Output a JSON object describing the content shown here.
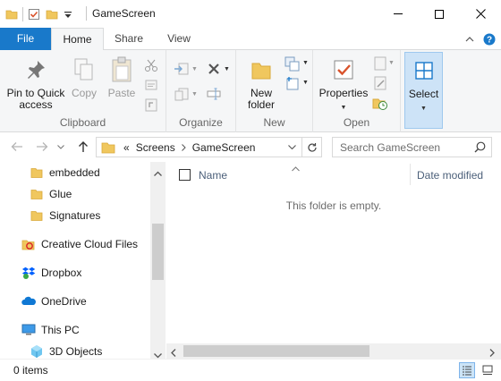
{
  "window": {
    "title": "GameScreen"
  },
  "tabs": {
    "file": "File",
    "home": "Home",
    "share": "Share",
    "view": "View"
  },
  "ribbon": {
    "clipboard": {
      "label": "Clipboard",
      "pin": "Pin to Quick\naccess",
      "copy": "Copy",
      "paste": "Paste"
    },
    "organize": {
      "label": "Organize"
    },
    "new": {
      "label": "New",
      "new_folder": "New\nfolder"
    },
    "open": {
      "label": "Open",
      "properties": "Properties"
    },
    "select": {
      "select": "Select"
    }
  },
  "address": {
    "overflow": "«",
    "crumbs": [
      "Screens",
      "GameScreen"
    ],
    "search_placeholder": "Search GameScreen"
  },
  "nav": {
    "items": [
      {
        "label": "embedded",
        "icon": "folder-icon"
      },
      {
        "label": "Glue",
        "icon": "folder-icon"
      },
      {
        "label": "Signatures",
        "icon": "folder-icon"
      },
      {
        "label": "Creative Cloud Files",
        "icon": "creative-cloud-icon"
      },
      {
        "label": "Dropbox",
        "icon": "dropbox-icon"
      },
      {
        "label": "OneDrive",
        "icon": "onedrive-icon"
      },
      {
        "label": "This PC",
        "icon": "computer-icon"
      },
      {
        "label": "3D Objects",
        "icon": "3d-objects-icon"
      }
    ]
  },
  "content": {
    "columns": {
      "name": "Name",
      "date_modified": "Date modified"
    },
    "empty_message": "This folder is empty."
  },
  "status": {
    "items_count": "0 items"
  },
  "colors": {
    "accent": "#1979ca",
    "folder": "#f0c75e",
    "ribbon_bg": "#f5f6f7"
  }
}
